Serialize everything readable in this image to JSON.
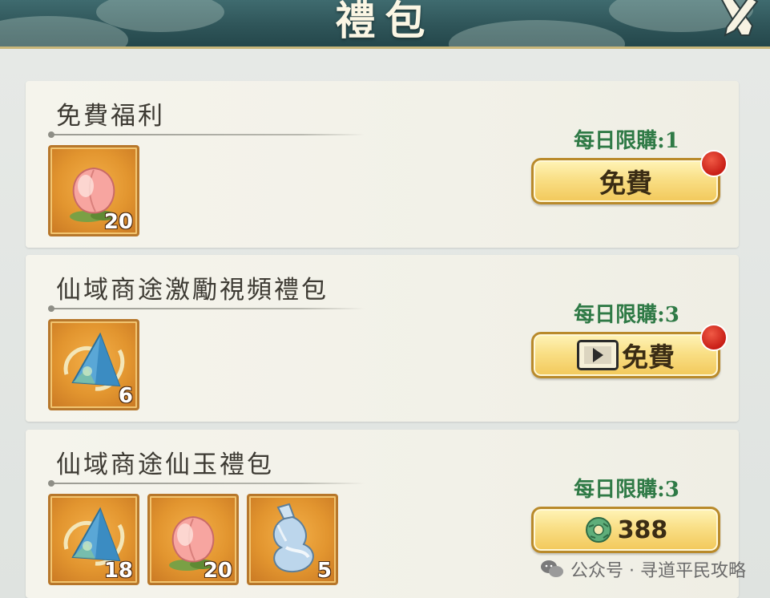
{
  "header": {
    "title": "禮包"
  },
  "colors": {
    "accent": "#2f7a46",
    "button": "#f9df86",
    "badge": "#c81e16",
    "frame": "#e2952f"
  },
  "packs": [
    {
      "title": "免費福利",
      "limit": "每日限購:1",
      "button_label": "免費",
      "button_type": "free",
      "has_red_dot": true,
      "items": [
        {
          "icon": "peach-icon",
          "count": "20"
        }
      ]
    },
    {
      "title": "仙域商途激勵視頻禮包",
      "limit": "每日限購:3",
      "button_label": "免費",
      "button_type": "video",
      "has_red_dot": true,
      "items": [
        {
          "icon": "jade-crystal-icon",
          "count": "6"
        }
      ]
    },
    {
      "title": "仙域商途仙玉禮包",
      "limit": "每日限購:3",
      "button_label": "388",
      "button_type": "jade",
      "has_red_dot": false,
      "items": [
        {
          "icon": "jade-crystal-icon",
          "count": "18"
        },
        {
          "icon": "peach-icon",
          "count": "20"
        },
        {
          "icon": "potion-gourd-icon",
          "count": "5"
        }
      ]
    }
  ],
  "watermark": {
    "text": "公众号 · 寻道平民攻略"
  }
}
